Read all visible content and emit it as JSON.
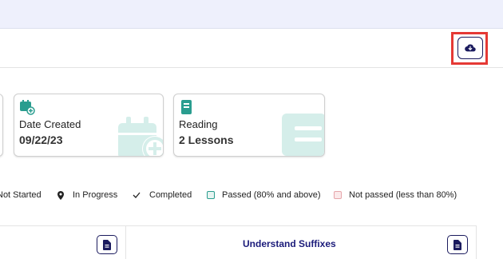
{
  "toolbar": {
    "download_icon": "cloud-download-icon"
  },
  "cards": [
    {
      "label": "Date Created",
      "value": "09/22/23",
      "icon": "calendar-add-icon",
      "accent": "#2a9d8f"
    },
    {
      "label": "Reading",
      "value": "2 Lessons",
      "icon": "book-icon",
      "accent": "#2a9d8f"
    }
  ],
  "legend": [
    {
      "label": "Not Started"
    },
    {
      "label": "In Progress",
      "icon": "map-pin-icon"
    },
    {
      "label": "Completed",
      "icon": "check-icon"
    },
    {
      "label": "Passed (80% and above)",
      "color": "#e6f4f1",
      "border": "#2a9d8f"
    },
    {
      "label": "Not passed (less than 80%)",
      "color": "#fbe9ea",
      "border": "#e6a5aa"
    }
  ],
  "table": {
    "columns": [
      "",
      "Understand Suffixes"
    ],
    "doc_icon": "document-icon"
  }
}
